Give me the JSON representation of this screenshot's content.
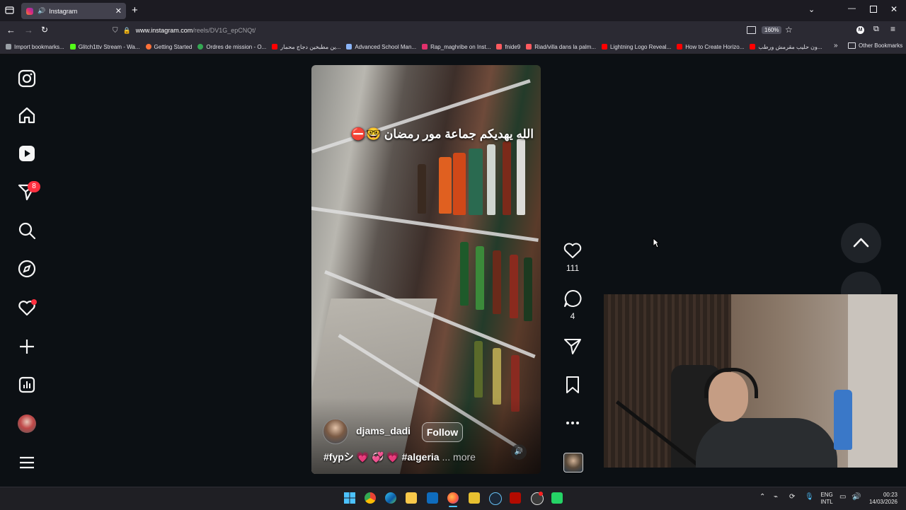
{
  "browser": {
    "tab_title": "Instagram",
    "url_host": "www.instagram.com",
    "url_path": "/reels/DV1G_epCNQt/",
    "zoom": "160%",
    "profile_initial": "M",
    "bookmarks": [
      {
        "label": "Import bookmarks...",
        "color": "#9aa0a6"
      },
      {
        "label": "Glitch1ttv Stream - Wa...",
        "color": "#53fc18"
      },
      {
        "label": "Getting Started",
        "color": "#ff7139"
      },
      {
        "label": "Ordres de mission - O...",
        "color": "#34a853"
      },
      {
        "label": "ين مطبخين دجاج محمار...",
        "color": "#ff0000"
      },
      {
        "label": "Advanced School Man...",
        "color": "#8ab4f8"
      },
      {
        "label": "Rap_maghribe on Inst...",
        "color": "#e1306c"
      },
      {
        "label": "fnide9",
        "color": "#ff5a5f"
      },
      {
        "label": "Riad/villa dans la palm...",
        "color": "#ff5a5f"
      },
      {
        "label": "Lightning Logo Reveal...",
        "color": "#ff0000"
      },
      {
        "label": "How to Create Horizo...",
        "color": "#ff0000"
      },
      {
        "label": "ون حليب مقرمش ورطب...",
        "color": "#ff0000"
      }
    ],
    "other_bookmarks": "Other Bookmarks"
  },
  "sidebar": {
    "items": [
      {
        "name": "instagram-logo-icon"
      },
      {
        "name": "home-icon"
      },
      {
        "name": "reels-icon"
      },
      {
        "name": "messages-icon",
        "badge": "8"
      },
      {
        "name": "search-icon"
      },
      {
        "name": "explore-icon"
      },
      {
        "name": "notifications-icon"
      },
      {
        "name": "create-icon"
      },
      {
        "name": "dashboard-icon"
      },
      {
        "name": "profile-avatar"
      },
      {
        "name": "more-menu-icon"
      }
    ]
  },
  "reel": {
    "overlay_text": "الله يهديكم جماعة مور رمضان 🤓⛔",
    "username": "djams_dadi",
    "follow_label": "Follow",
    "caption": "#fypシ 💗 💞 💗 #algeria",
    "caption_more": "... more",
    "likes": "111",
    "comments": "4"
  },
  "taskbar": {
    "lang_top": "ENG",
    "lang_bottom": "INTL",
    "time": "00:23",
    "date": "14/03/2026"
  },
  "colors": {
    "accent_badge": "#ff3040",
    "ig_bg": "#0c1014",
    "follow_bg": "#ffffff33"
  }
}
